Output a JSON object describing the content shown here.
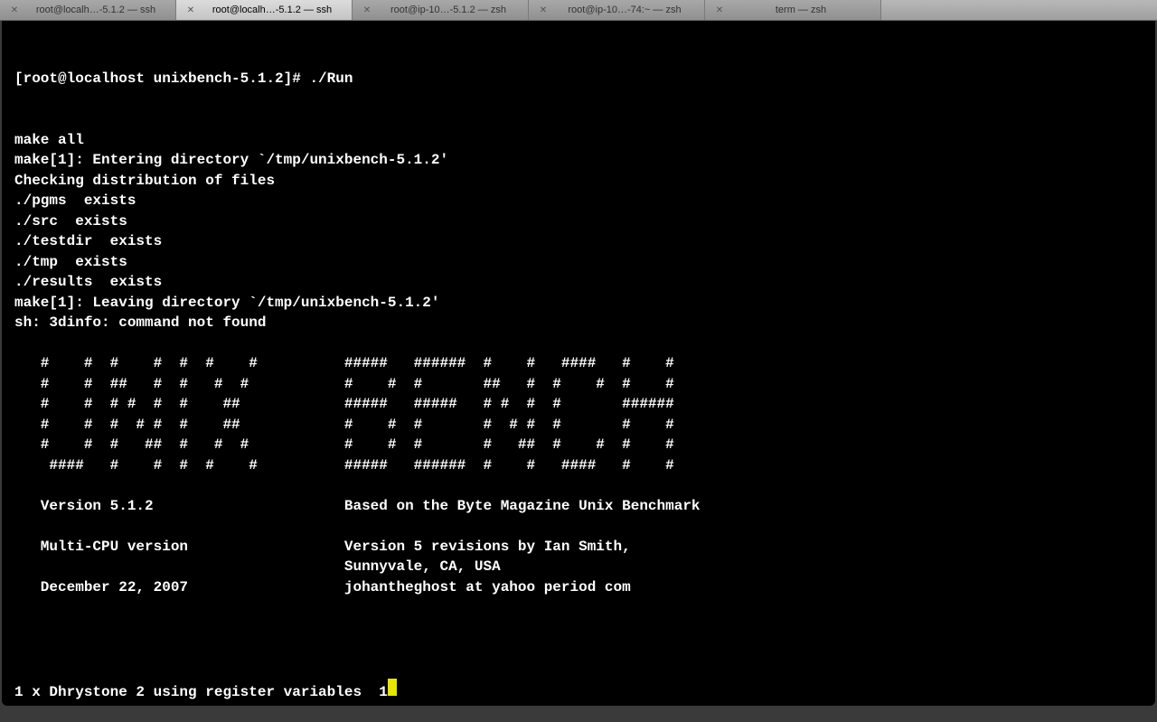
{
  "tabs": [
    {
      "label": "root@localh…-5.1.2 — ssh",
      "active": false
    },
    {
      "label": "root@localh…-5.1.2 — ssh",
      "active": true
    },
    {
      "label": "root@ip-10…-5.1.2 — zsh",
      "active": false
    },
    {
      "label": "root@ip-10…-74:~ — zsh",
      "active": false
    },
    {
      "label": "term — zsh",
      "active": false
    }
  ],
  "terminal": {
    "prompt_line": "[root@localhost unixbench-5.1.2]# ./Run",
    "lines": [
      "make all",
      "make[1]: Entering directory `/tmp/unixbench-5.1.2'",
      "Checking distribution of files",
      "./pgms  exists",
      "./src  exists",
      "./testdir  exists",
      "./tmp  exists",
      "./results  exists",
      "make[1]: Leaving directory `/tmp/unixbench-5.1.2'",
      "sh: 3dinfo: command not found",
      "",
      "   #    #  #    #  #  #    #          #####   ######  #    #   ####   #    #",
      "   #    #  ##   #  #   #  #           #    #  #       ##   #  #    #  #    #",
      "   #    #  # #  #  #    ##            #####   #####   # #  #  #       ######",
      "   #    #  #  # #  #    ##            #    #  #       #  # #  #       #    #",
      "   #    #  #   ##  #   #  #           #    #  #       #   ##  #    #  #    #",
      "    ####   #    #  #  #    #          #####   ######  #    #   ####   #    #",
      "",
      "   Version 5.1.2                      Based on the Byte Magazine Unix Benchmark",
      "",
      "   Multi-CPU version                  Version 5 revisions by Ian Smith,",
      "                                      Sunnyvale, CA, USA",
      "   December 22, 2007                  johantheghost at yahoo period com",
      "",
      ""
    ],
    "running_line_prefix": "1 x Dhrystone 2 using register variables  1"
  }
}
